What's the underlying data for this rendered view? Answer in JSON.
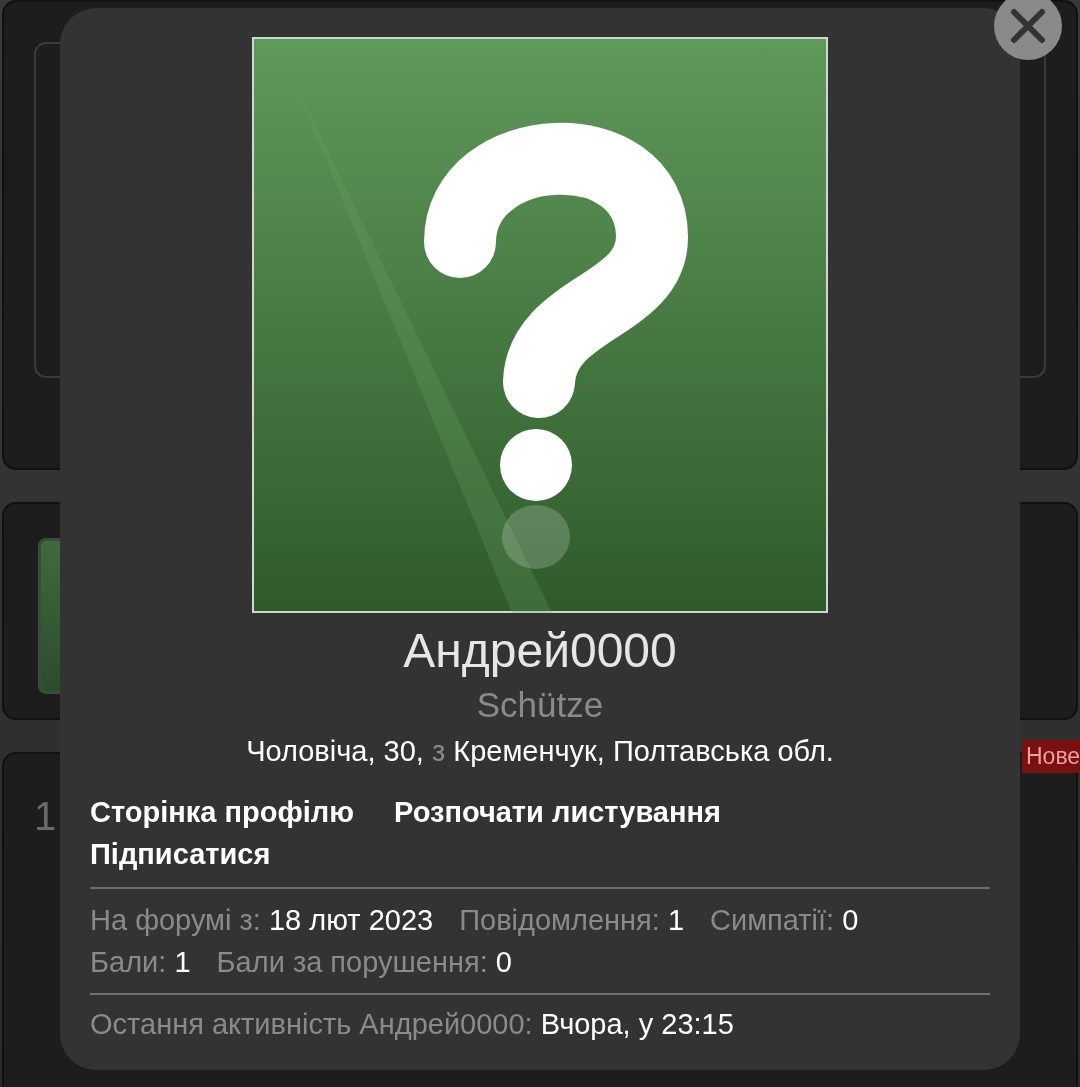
{
  "background": {
    "counter": "1",
    "badge": "Нове"
  },
  "profile": {
    "username": "Андрей0000",
    "title": "Schütze",
    "location": [
      {
        "text": "Чоловіча, 30,",
        "muted": false
      },
      {
        "text": "з",
        "muted": true
      },
      {
        "text": "Кременчук, Полтавська обл.",
        "muted": false
      }
    ],
    "links": [
      "Сторінка профілю",
      "Розпочати листування",
      "Підписатися"
    ],
    "stats": [
      {
        "label": "На форумі з:",
        "value": "18 лют 2023"
      },
      {
        "label": "Повідомлення:",
        "value": "1"
      },
      {
        "label": "Симпатії:",
        "value": "0"
      },
      {
        "label": "Бали:",
        "value": "1"
      },
      {
        "label": "Бали за порушення:",
        "value": "0"
      }
    ],
    "last_activity": {
      "label": "Остання активність Андрей0000:",
      "value": "Вчора, у 23:15"
    }
  }
}
